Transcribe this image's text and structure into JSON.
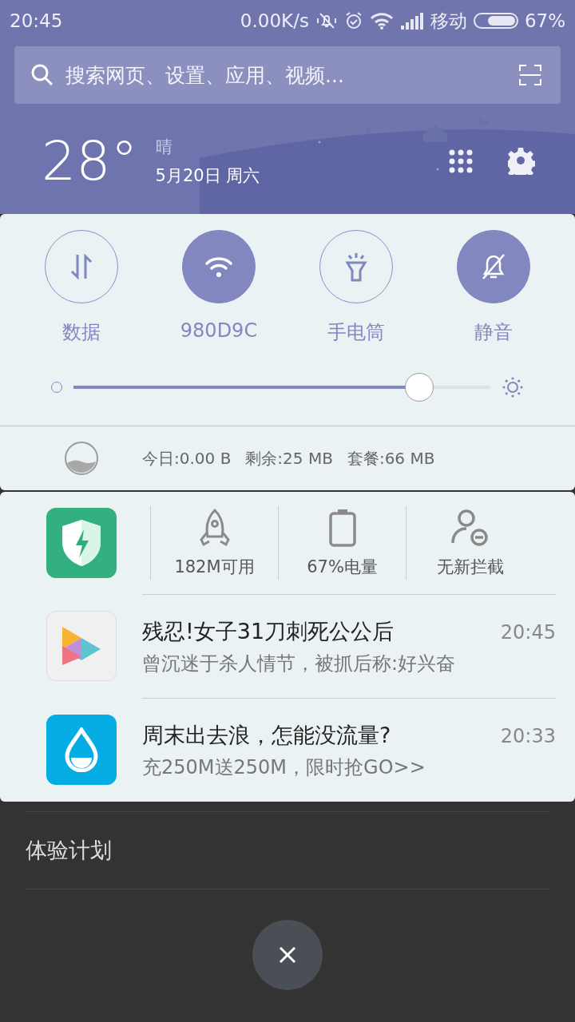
{
  "status_bar": {
    "time": "20:45",
    "speed": "0.00K/s",
    "carrier": "移动",
    "battery": "67%"
  },
  "search": {
    "placeholder": "搜索网页、设置、应用、视频..."
  },
  "weather": {
    "temp": "28°",
    "condition": "晴",
    "date": "5月20日 周六"
  },
  "toggles": [
    {
      "kind": "data",
      "label": "数据",
      "on": false
    },
    {
      "kind": "wifi",
      "label": "980D9C",
      "on": true
    },
    {
      "kind": "flashlight",
      "label": "手电筒",
      "on": false
    },
    {
      "kind": "silent",
      "label": "静音",
      "on": true
    }
  ],
  "brightness": {
    "level": 0.83
  },
  "data_usage": {
    "today": "今日:0.00 B",
    "remaining": "剩余:25 MB",
    "plan": "套餐:66 MB"
  },
  "shortcuts": [
    {
      "kind": "rocket",
      "label": "182M可用"
    },
    {
      "kind": "battery",
      "label": "67%电量"
    },
    {
      "kind": "block",
      "label": "无新拦截"
    }
  ],
  "notifications": [
    {
      "kind": "video",
      "title": "残忍!女子31刀刺死公公后",
      "time": "20:45",
      "text": "曾沉迷于杀人情节，被抓后称:好兴奋"
    },
    {
      "kind": "water",
      "title": "周末出去浪，怎能没流量?",
      "time": "20:33",
      "text": "充250M送250M，限时抢GO>>"
    }
  ],
  "menu": {
    "item": "体验计划"
  }
}
